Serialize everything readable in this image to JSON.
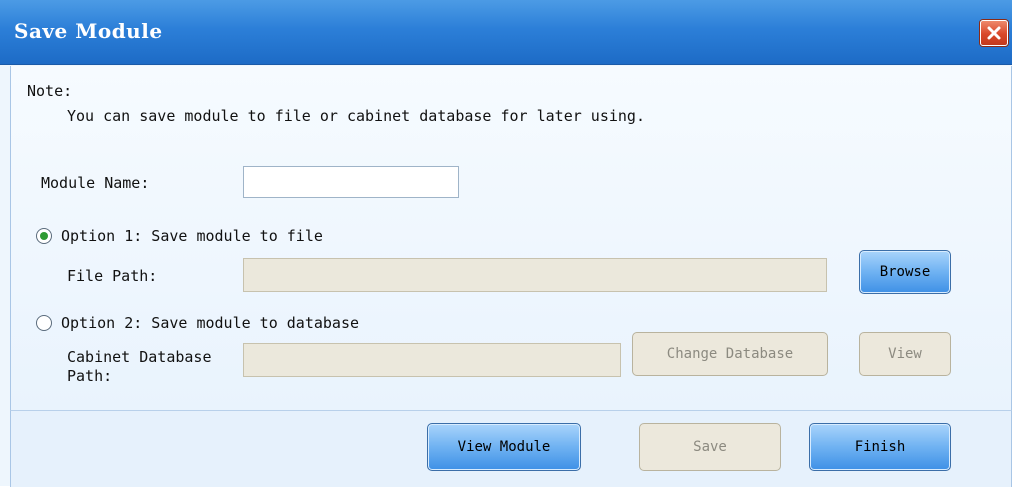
{
  "window": {
    "title": "Save Module",
    "close_icon": "close-icon"
  },
  "note": {
    "label": "Note:",
    "text": "You can save module to file or cabinet database for later using."
  },
  "module_name": {
    "label": "Module Name:",
    "value": ""
  },
  "option1": {
    "label": "Option 1: Save module to file",
    "selected": true,
    "file_path_label": "File Path:",
    "file_path_value": "",
    "browse_label": "Browse"
  },
  "option2": {
    "label": "Option 2: Save module to database",
    "selected": false,
    "db_path_label_line1": "Cabinet Database",
    "db_path_label_line2": "Path:",
    "db_path_value": "",
    "change_db_label": "Change Database",
    "view_label": "View"
  },
  "footer": {
    "view_module_label": "View Module",
    "save_label": "Save",
    "finish_label": "Finish"
  },
  "colors": {
    "title_bar": "#2c7fd8",
    "panel_bg": "#eef6fd",
    "radio_selected": "#2e9a32",
    "close_button": "#d9482a"
  }
}
